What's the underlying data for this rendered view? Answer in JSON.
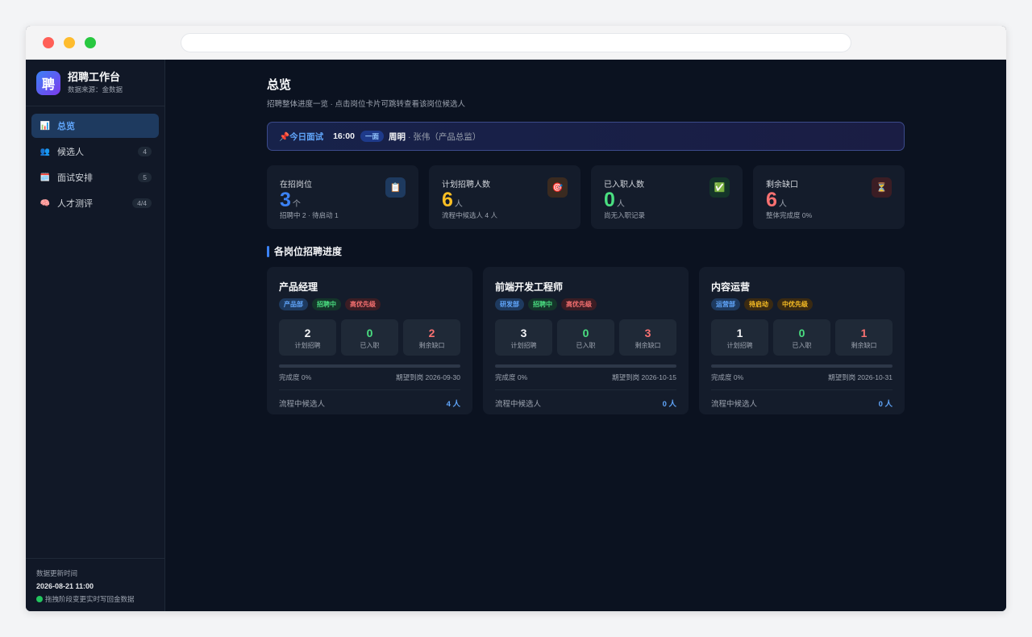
{
  "sidebar": {
    "logo_char": "聘",
    "title": "招聘工作台",
    "subtitle": "数据来源：金数据",
    "items": [
      {
        "icon": "📊",
        "label": "总览",
        "badge": ""
      },
      {
        "icon": "👥",
        "label": "候选人",
        "badge": "4"
      },
      {
        "icon": "🗓️",
        "label": "面试安排",
        "badge": "5"
      },
      {
        "icon": "🧠",
        "label": "人才测评",
        "badge": "4/4"
      }
    ],
    "footer": {
      "label": "数据更新时间",
      "time": "2026-08-21 11:00",
      "note": "拖拽阶段变更实时写回金数据"
    }
  },
  "header": {
    "title": "总览",
    "subtitle": "招聘整体进度一览 · 点击岗位卡片可跳转查看该岗位候选人"
  },
  "banner": {
    "icon": "📌",
    "label": "今日面试",
    "time": "16:00",
    "round": "一面",
    "name": "周明",
    "role": "· 张伟（产品总监）"
  },
  "stats": [
    {
      "label": "在招岗位",
      "value": "3",
      "unit": "个",
      "sub": "招聘中 2 · 待启动 1",
      "icon": "📋"
    },
    {
      "label": "计划招聘人数",
      "value": "6",
      "unit": "人",
      "sub": "流程中候选人 4 人",
      "icon": "🎯"
    },
    {
      "label": "已入职人数",
      "value": "0",
      "unit": "人",
      "sub": "尚无入职记录",
      "icon": "✅"
    },
    {
      "label": "剩余缺口",
      "value": "6",
      "unit": "人",
      "sub": "整体完成度 0%",
      "icon": "⏳"
    }
  ],
  "section_title": "各岗位招聘进度",
  "jobs": [
    {
      "title": "产品经理",
      "tags": [
        "产品部",
        "招聘中",
        "高优先级"
      ],
      "planned": "2",
      "planned_label": "计划招聘",
      "hired": "0",
      "hired_label": "已入职",
      "gap": "2",
      "gap_label": "剩余缺口",
      "progress": 0,
      "completion": "完成度 0%",
      "deadline": "期望到岗 2026-09-30",
      "cand_label": "流程中候选人",
      "cand_value": "4 人"
    },
    {
      "title": "前端开发工程师",
      "tags": [
        "研发部",
        "招聘中",
        "高优先级"
      ],
      "planned": "3",
      "planned_label": "计划招聘",
      "hired": "0",
      "hired_label": "已入职",
      "gap": "3",
      "gap_label": "剩余缺口",
      "progress": 0,
      "completion": "完成度 0%",
      "deadline": "期望到岗 2026-10-15",
      "cand_label": "流程中候选人",
      "cand_value": "0 人"
    },
    {
      "title": "内容运营",
      "tags": [
        "运营部",
        "待启动",
        "中优先级"
      ],
      "planned": "1",
      "planned_label": "计划招聘",
      "hired": "0",
      "hired_label": "已入职",
      "gap": "1",
      "gap_label": "剩余缺口",
      "progress": 0,
      "completion": "完成度 0%",
      "deadline": "期望到岗 2026-10-31",
      "cand_label": "流程中候选人",
      "cand_value": "0 人"
    }
  ]
}
